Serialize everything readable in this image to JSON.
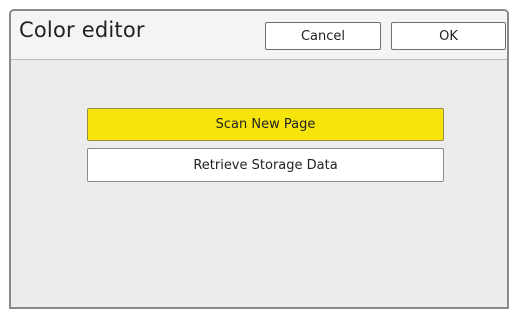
{
  "header": {
    "title": "Color editor",
    "cancel_label": "Cancel",
    "ok_label": "OK"
  },
  "main": {
    "buttons": [
      {
        "label": "Scan New Page",
        "state": "selected",
        "color": "#f7e40a"
      },
      {
        "label": "Retrieve Storage Data",
        "state": "normal",
        "color": "#ffffff"
      }
    ]
  }
}
